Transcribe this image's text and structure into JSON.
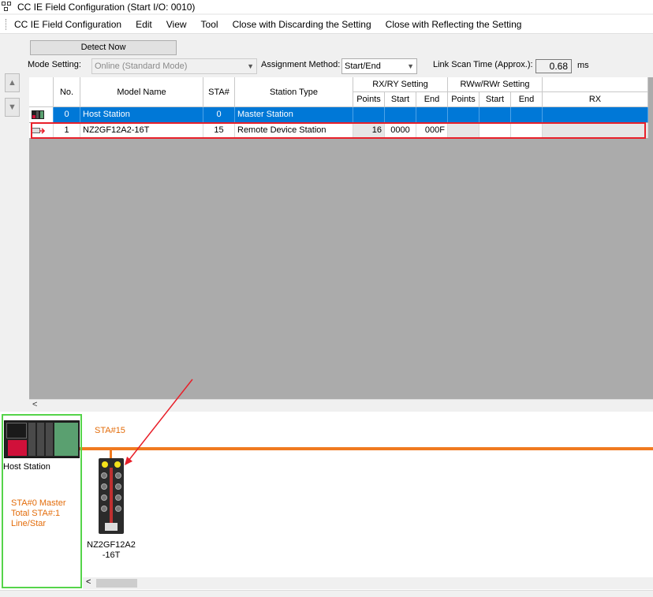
{
  "window": {
    "title": "CC IE Field Configuration (Start I/O: 0010)"
  },
  "menu": [
    "CC IE Field Configuration",
    "Edit",
    "View",
    "Tool",
    "Close with Discarding the Setting",
    "Close with Reflecting the Setting"
  ],
  "toolbar": {
    "detect_label": "Detect Now",
    "mode_label": "Mode Setting:",
    "mode_value": "Online (Standard Mode)",
    "assign_label": "Assignment Method:",
    "assign_value": "Start/End",
    "scan_label": "Link Scan Time (Approx.):",
    "scan_value": "0.68",
    "scan_unit": "ms"
  },
  "grid": {
    "headers": {
      "no": "No.",
      "model": "Model Name",
      "sta": "STA#",
      "type": "Station Type",
      "rxry": "RX/RY Setting",
      "rww": "RWw/RWr Setting",
      "points": "Points",
      "start": "Start",
      "end": "End",
      "points2": "Points",
      "start2": "Start",
      "end2": "End",
      "rx": "RX"
    },
    "rows": [
      {
        "no": "0",
        "model": "Host Station",
        "sta": "0",
        "type": "Master Station",
        "points": "",
        "start": "",
        "end": ""
      },
      {
        "no": "1",
        "model": "NZ2GF12A2-16T",
        "sta": "15",
        "type": "Remote Device Station",
        "points": "16",
        "start": "0000",
        "end": "000F"
      }
    ]
  },
  "scroll": {
    "left_arrow": "<"
  },
  "network": {
    "sta_label": "STA#15",
    "host_name": "Host Station",
    "host_info": [
      "STA#0  Master",
      "Total STA#:1",
      "Line/Star"
    ],
    "device_name_1": "NZ2GF12A2",
    "device_name_2": "-16T"
  },
  "colors": {
    "accent_orange": "#f07a20",
    "select_blue": "#0078d7",
    "highlight_red": "#e8202a",
    "host_green": "#55d44a"
  }
}
